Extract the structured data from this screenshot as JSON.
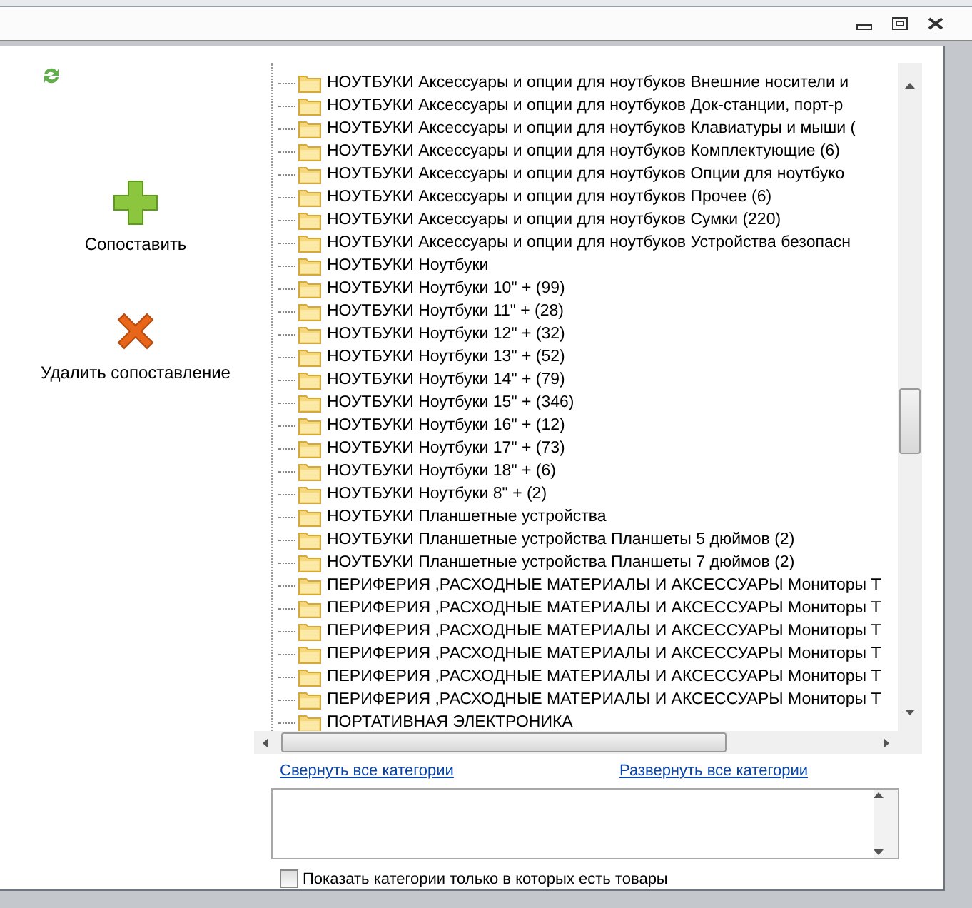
{
  "actions": [
    {
      "kind": "add",
      "label": "Сопоставить"
    },
    {
      "kind": "remove",
      "label": "Удалить сопоставление"
    }
  ],
  "tree": {
    "items": [
      {
        "label": "НОУТБУКИ Аксессуары и опции для ноутбуков Внешние носители и"
      },
      {
        "label": "НОУТБУКИ Аксессуары и опции для ноутбуков Док-станции, порт-р"
      },
      {
        "label": "НОУТБУКИ Аксессуары и опции для ноутбуков Клавиатуры и мыши ("
      },
      {
        "label": "НОУТБУКИ Аксессуары и опции для ноутбуков Комплектующие (6)"
      },
      {
        "label": "НОУТБУКИ Аксессуары и опции для ноутбуков Опции для ноутбуко"
      },
      {
        "label": "НОУТБУКИ Аксессуары и опции для ноутбуков Прочее (6)"
      },
      {
        "label": "НОУТБУКИ Аксессуары и опции для ноутбуков Сумки (220)"
      },
      {
        "label": "НОУТБУКИ Аксессуары и опции для ноутбуков Устройства безопасн"
      },
      {
        "label": "НОУТБУКИ Ноутбуки"
      },
      {
        "label": "НОУТБУКИ Ноутбуки 10\" + (99)"
      },
      {
        "label": "НОУТБУКИ Ноутбуки 11\" + (28)"
      },
      {
        "label": "НОУТБУКИ Ноутбуки 12\" + (32)"
      },
      {
        "label": "НОУТБУКИ Ноутбуки 13\" + (52)"
      },
      {
        "label": "НОУТБУКИ Ноутбуки 14\" + (79)"
      },
      {
        "label": "НОУТБУКИ Ноутбуки 15\" + (346)"
      },
      {
        "label": "НОУТБУКИ Ноутбуки 16\" + (12)"
      },
      {
        "label": "НОУТБУКИ Ноутбуки 17\" + (73)"
      },
      {
        "label": "НОУТБУКИ Ноутбуки 18\" + (6)"
      },
      {
        "label": "НОУТБУКИ Ноутбуки 8\" + (2)"
      },
      {
        "label": "НОУТБУКИ Планшетные устройства"
      },
      {
        "label": "НОУТБУКИ Планшетные устройства Планшеты 5 дюймов (2)"
      },
      {
        "label": "НОУТБУКИ Планшетные устройства Планшеты 7 дюймов (2)"
      },
      {
        "label": "ПЕРИФЕРИЯ ,РАСХОДНЫЕ МАТЕРИАЛЫ И АКСЕССУАРЫ Мониторы T"
      },
      {
        "label": "ПЕРИФЕРИЯ ,РАСХОДНЫЕ МАТЕРИАЛЫ И АКСЕССУАРЫ Мониторы T"
      },
      {
        "label": "ПЕРИФЕРИЯ ,РАСХОДНЫЕ МАТЕРИАЛЫ И АКСЕССУАРЫ Мониторы T"
      },
      {
        "label": "ПЕРИФЕРИЯ ,РАСХОДНЫЕ МАТЕРИАЛЫ И АКСЕССУАРЫ Мониторы T"
      },
      {
        "label": "ПЕРИФЕРИЯ ,РАСХОДНЫЕ МАТЕРИАЛЫ И АКСЕССУАРЫ Мониторы T"
      },
      {
        "label": "ПЕРИФЕРИЯ ,РАСХОДНЫЕ МАТЕРИАЛЫ И АКСЕССУАРЫ Мониторы T"
      },
      {
        "label": "ПОРТАТИВНАЯ ЭЛЕКТРОНИКА"
      }
    ]
  },
  "links": [
    "Свернуть все категории",
    "Развернуть все категории"
  ],
  "only_with_products": {
    "label": "Показать категории только в которых есть товары",
    "checked": false
  }
}
